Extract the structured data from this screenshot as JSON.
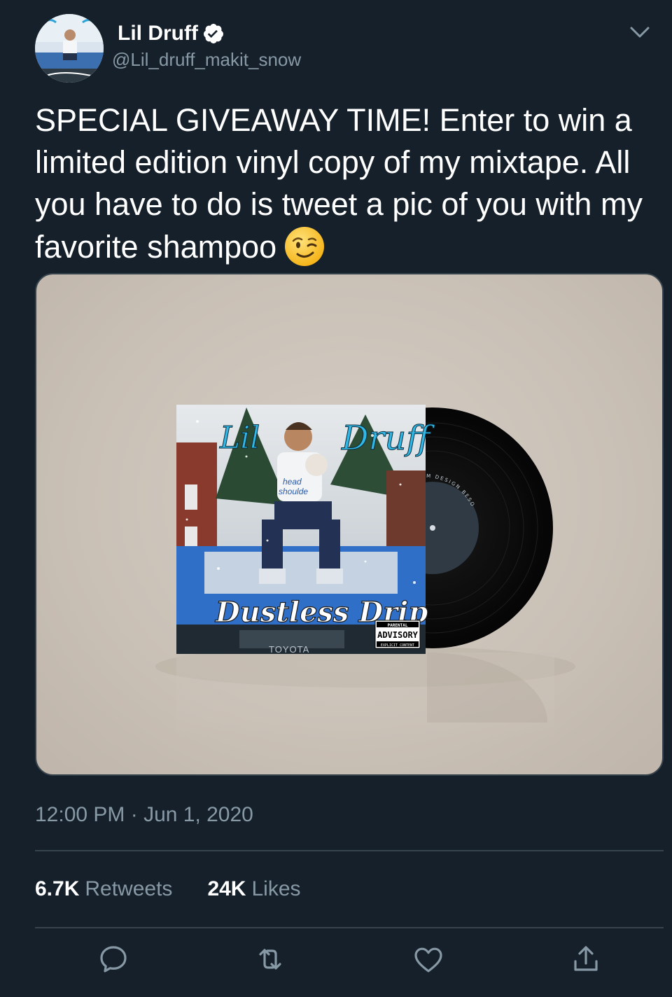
{
  "author": {
    "display_name": "Lil Druff",
    "handle": "@Lil_druff_makit_snow",
    "verified": true
  },
  "tweet": {
    "text": "SPECIAL GIVEAWAY TIME! Enter to win a limited edition vinyl copy of my mixtape. All you have to do is tweet a pic of you with my favorite shampoo",
    "emoji": "winking-face"
  },
  "media": {
    "album_title_top_left": "Lil",
    "album_title_top_right": "Druff",
    "album_subtitle": "Dustless Drip",
    "advisory_line1": "PARENTAL",
    "advisory_line2": "ADVISORY",
    "advisory_line3": "EXPLICIT CONTENT",
    "truck_brand": "TOYOTA",
    "shirt_text_1": "head",
    "shirt_text_2": "shoulde",
    "label_text": "PREMIUM DESIGN BESO"
  },
  "timestamp": "12:00 PM · Jun 1, 2020",
  "stats": {
    "retweets_count": "6.7K",
    "retweets_label": "Retweets",
    "likes_count": "24K",
    "likes_label": "Likes"
  },
  "colors": {
    "background": "#15202b",
    "secondary_text": "#8899a6",
    "divider": "#38444d",
    "verified": "#ffffff"
  }
}
